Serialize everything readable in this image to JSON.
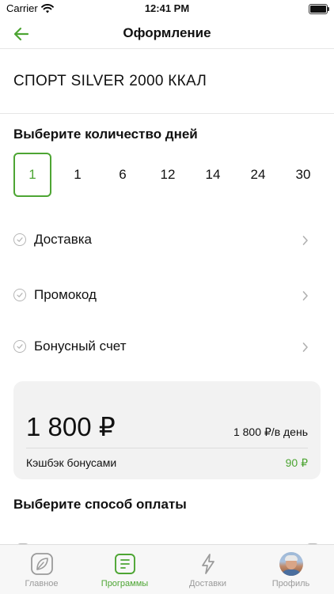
{
  "status_bar": {
    "carrier": "Carrier",
    "time": "12:41 PM"
  },
  "nav": {
    "title": "Оформление"
  },
  "program": {
    "title": "СПОРТ SILVER 2000 ККАЛ"
  },
  "days": {
    "heading": "Выберите количество дней",
    "options": [
      "1",
      "1",
      "6",
      "12",
      "14",
      "24",
      "30"
    ],
    "selected_index": 0
  },
  "options": [
    {
      "label": "Доставка"
    },
    {
      "label": "Промокод"
    },
    {
      "label": "Бонусный счет"
    }
  ],
  "price": {
    "amount": "1 800 ₽",
    "per_day": "1 800 ₽/в день",
    "cashback_label": "Кэшбэк бонусами",
    "cashback_value": "90 ₽"
  },
  "payment": {
    "heading": "Выберите способ оплаты"
  },
  "tabbar": {
    "tabs": [
      {
        "label": "Главное",
        "icon": "leaf-icon"
      },
      {
        "label": "Программы",
        "icon": "programs-icon"
      },
      {
        "label": "Доставки",
        "icon": "lightning-icon"
      },
      {
        "label": "Профиль",
        "icon": "avatar"
      }
    ],
    "active_index": 1
  },
  "colors": {
    "accent": "#4da533",
    "muted": "#9a9a9a",
    "card": "#f2f2f2"
  }
}
